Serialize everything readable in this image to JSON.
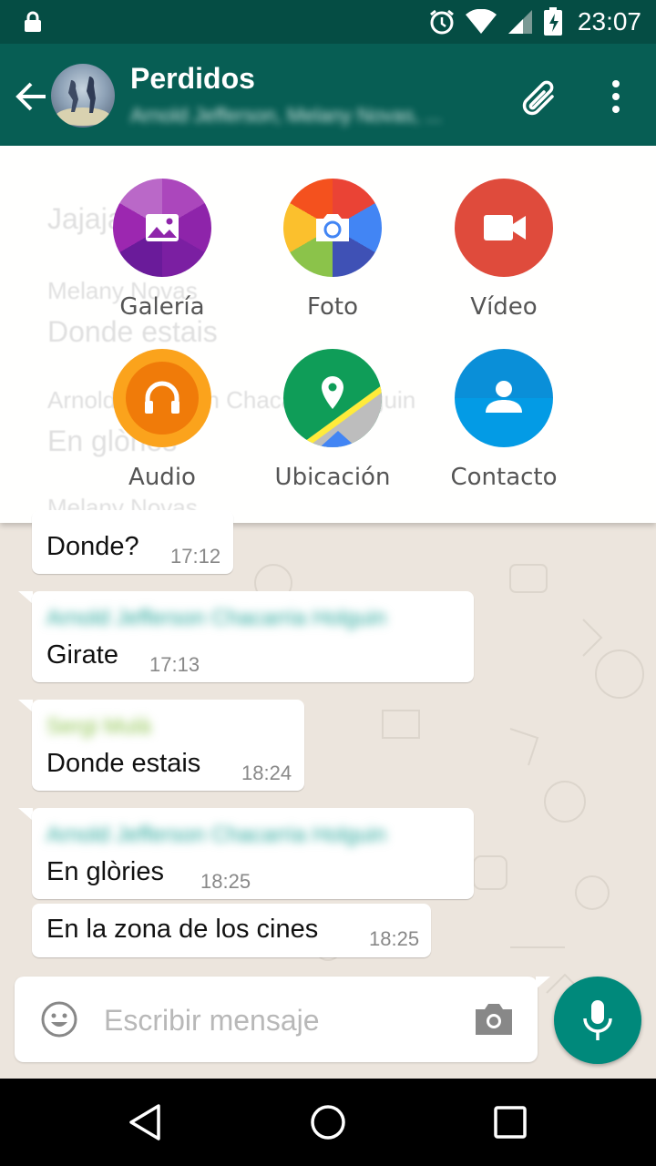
{
  "status_bar": {
    "time": "23:07"
  },
  "header": {
    "title": "Perdidos",
    "subtitle": "Arnold Jefferson, Melany Novas, ..."
  },
  "attach_menu": {
    "options": [
      {
        "label": "Galería",
        "icon": "gallery-icon",
        "color": "#9c27b0"
      },
      {
        "label": "Foto",
        "icon": "camera-icon",
        "color": "#4285f4"
      },
      {
        "label": "Vídeo",
        "icon": "video-icon",
        "color": "#e53935"
      },
      {
        "label": "Audio",
        "icon": "headphones-icon",
        "color": "#f57c00"
      },
      {
        "label": "Ubicación",
        "icon": "location-icon",
        "color": "#0f9d58"
      },
      {
        "label": "Contacto",
        "icon": "contact-icon",
        "color": "#039be5"
      }
    ],
    "ghost_lines": [
      "Jajaja",
      "Melany Novas",
      "Donde estais",
      "Arnold Jefferson Chacarria Holguin",
      "En glòries",
      "Melany Novas"
    ]
  },
  "messages": [
    {
      "text": "Donde?",
      "time": "17:12"
    },
    {
      "sender": "Arnold Jefferson Chacarria Holguin",
      "sender_color": "#26a69a",
      "text": "Girate",
      "time": "17:13"
    },
    {
      "sender": "Sergi Mulà",
      "sender_color": "#8bc34a",
      "text": "Donde estais",
      "time": "18:24"
    },
    {
      "sender": "Arnold Jefferson Chacarria Holguin",
      "sender_color": "#26a69a",
      "text": "En glòries",
      "time": "18:25"
    },
    {
      "text": "En la zona de los cines",
      "time": "18:25"
    }
  ],
  "composer": {
    "placeholder": "Escribir mensaje"
  },
  "colors": {
    "primary_dark": "#054d44",
    "primary": "#075e54",
    "accent": "#00897b",
    "chat_bg": "#ece5dd"
  }
}
